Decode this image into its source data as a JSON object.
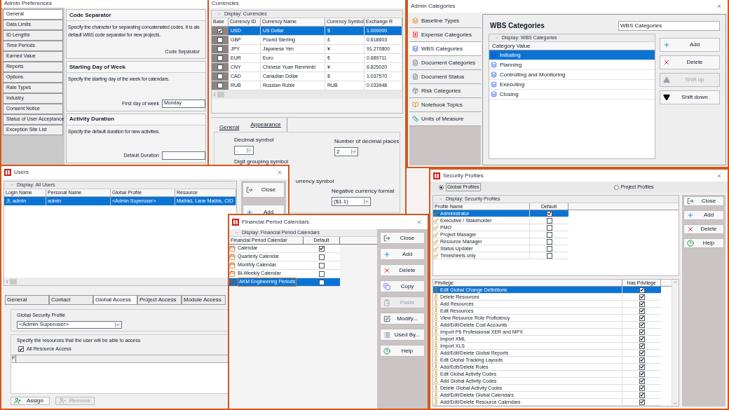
{
  "admin_preferences": {
    "title": "Admin Preferences",
    "tabs": [
      {
        "label": "General",
        "selected": true
      },
      {
        "label": "Data Limits",
        "selected": false
      },
      {
        "label": "ID Lengths",
        "selected": false
      },
      {
        "label": "Time Periods",
        "selected": false
      },
      {
        "label": "Earned Value",
        "selected": false
      },
      {
        "label": "Reports",
        "selected": false
      },
      {
        "label": "Options",
        "selected": false
      },
      {
        "label": "Rate Types",
        "selected": false
      },
      {
        "label": "Industry",
        "selected": false
      },
      {
        "label": "Consent Notice",
        "selected": false
      },
      {
        "label": "Status of User Acceptance",
        "selected": false
      },
      {
        "label": "Exception Site List",
        "selected": false
      }
    ],
    "sections": [
      {
        "heading": "Code Separator",
        "lines": [
          "Specify the character for separating concatenated codes.  It is als",
          "default WBS code separator for new projects."
        ],
        "field": {
          "label": "Code Separator",
          "kind": "label_only"
        }
      },
      {
        "heading": "Starting Day of Week",
        "lines": [
          "Specify the starting day of the week for calendars."
        ],
        "field": {
          "label": "First day of week",
          "kind": "input",
          "value": "Monday"
        }
      },
      {
        "heading": "Activity Duration",
        "lines": [
          "Specify the default duration for new activities."
        ],
        "field": {
          "label": "Default Duration",
          "kind": "input"
        }
      }
    ]
  },
  "currencies": {
    "title": "Currencies",
    "display": "Display: Currencies",
    "base_column": "Base",
    "columns": [
      "Currency ID",
      "Currency Name",
      "Currency Symbol",
      "Exchange R"
    ],
    "rows": [
      {
        "base": true,
        "selected": true,
        "cells": [
          "USD",
          "US Dollar",
          "$",
          "1.000000"
        ]
      },
      {
        "base": false,
        "selected": false,
        "cells": [
          "GBP",
          "Pound Sterling",
          "£",
          "0.618603"
        ]
      },
      {
        "base": false,
        "selected": false,
        "cells": [
          "JPY",
          "Japanese Yen",
          "¥",
          "91.270800"
        ]
      },
      {
        "base": false,
        "selected": false,
        "cells": [
          "EUR",
          "Euro",
          "€",
          "0.689711"
        ]
      },
      {
        "base": false,
        "selected": false,
        "cells": [
          "CNY",
          "Chinese Yuan Renminbi",
          "¥",
          "6.825020"
        ]
      },
      {
        "base": false,
        "selected": false,
        "cells": [
          "CAD",
          "Canadian Dollar",
          "$",
          "1.037570"
        ]
      },
      {
        "base": false,
        "selected": false,
        "cells": [
          "RUB",
          "Russian Ruble",
          "RUB",
          "0.033948"
        ]
      }
    ],
    "tabs": [
      {
        "label": "General",
        "selected": false
      },
      {
        "label": "Appearance",
        "selected": true
      }
    ],
    "decimal_symbol": {
      "label": "Decimal symbol",
      "value": "."
    },
    "decimal_places": {
      "label": "Number of decimal places",
      "value": "2"
    },
    "digit_grouping": {
      "label": "Digit grouping symbol"
    },
    "currency_symbol": {
      "label": "urrency symbol"
    },
    "negative_format": {
      "label": "Negative currency format",
      "value": "($1.1)"
    }
  },
  "admin_categories": {
    "title": "Admin Categories",
    "nav": [
      {
        "label": "Baseline Types",
        "selected": false
      },
      {
        "label": "Expense Categories",
        "selected": false
      },
      {
        "label": "WBS Categories",
        "selected": true
      },
      {
        "label": "Document Categories",
        "selected": false
      },
      {
        "label": "Document Status",
        "selected": false
      },
      {
        "label": "Risk Categories",
        "selected": false
      },
      {
        "label": "Notebook Topics",
        "selected": false
      },
      {
        "label": "Units of Measure",
        "selected": false
      }
    ],
    "heading": "WBS Categories",
    "name_value": "WBS Categories",
    "display": "Display: WBS Categories",
    "column": "Category Value",
    "rows": [
      {
        "label": "Initiating",
        "selected": true
      },
      {
        "label": "Planning",
        "selected": false
      },
      {
        "label": "Controlling and Monitoring",
        "selected": false
      },
      {
        "label": "Executing",
        "selected": false
      },
      {
        "label": "Closing",
        "selected": false
      }
    ],
    "buttons": [
      {
        "label": "Add",
        "kind": "add",
        "disabled": false
      },
      {
        "label": "Delete",
        "kind": "delete",
        "disabled": false
      },
      {
        "label": "Shift up",
        "kind": "shift_up",
        "disabled": true
      },
      {
        "label": "Shift down",
        "kind": "shift_down",
        "disabled": false
      }
    ]
  },
  "users": {
    "title": "Users",
    "display": "Display: All Users",
    "columns": [
      "Login Name",
      "Personal Name",
      "Global Profile",
      "Resource"
    ],
    "rows": [
      {
        "selected": true,
        "cells": [
          "admin",
          "admin",
          "<Admin Superuser>",
          "MathisL Lane Mathis, CIO"
        ]
      }
    ],
    "buttons": [
      {
        "label": "Close",
        "kind": "close",
        "disabled": false
      },
      {
        "label": "Add",
        "kind": "add",
        "disabled": false
      }
    ],
    "tabs": [
      {
        "label": "General",
        "selected": false
      },
      {
        "label": "Contact",
        "selected": false
      },
      {
        "label": "Global Access",
        "selected": true
      },
      {
        "label": "Project Access",
        "selected": false
      },
      {
        "label": "Module Access",
        "selected": false
      }
    ],
    "profile": {
      "label": "Global Security Profile",
      "value": "<Admin Superuser>"
    },
    "access_note": "Specify the resources that the user will be able to access",
    "all_access": {
      "label": "All Resource Access",
      "checked": true
    },
    "grid_column": "F",
    "bottom_buttons": [
      {
        "label": "Assign",
        "kind": "assign",
        "disabled": false
      },
      {
        "label": "Remove",
        "kind": "remove",
        "disabled": true
      }
    ]
  },
  "financial_calendars": {
    "title": "Financial Period Calendars",
    "display": "Display: Financial Period Calendars",
    "columns": [
      "Financial Period Calendar",
      "Default"
    ],
    "rows": [
      {
        "label": "Calendar",
        "default": true,
        "selected": false
      },
      {
        "label": "Quarterly Calendar",
        "default": false,
        "selected": false
      },
      {
        "label": "Monthly Calendar",
        "default": false,
        "selected": false
      },
      {
        "label": "Bi-Weekly Calendar",
        "default": false,
        "selected": false
      },
      {
        "label": "AKM Engineering Periods",
        "default": false,
        "selected": true
      }
    ],
    "buttons": [
      {
        "label": "Close",
        "kind": "close",
        "disabled": false
      },
      {
        "label": "Add",
        "kind": "add",
        "disabled": false
      },
      {
        "label": "Delete",
        "kind": "delete",
        "disabled": false
      },
      {
        "label": "Copy",
        "kind": "copy",
        "disabled": false
      },
      {
        "label": "Paste",
        "kind": "paste",
        "disabled": true
      },
      {
        "label": "Modify...",
        "kind": "modify",
        "disabled": false
      },
      {
        "label": "Used By...",
        "kind": "used_by",
        "disabled": false
      },
      {
        "label": "Help",
        "kind": "help",
        "disabled": false
      }
    ]
  },
  "security_profiles": {
    "title": "Security Profiles",
    "scopes": [
      {
        "label": "Global Profiles",
        "selected": true
      },
      {
        "label": "Project Profiles",
        "selected": false
      }
    ],
    "display": "Display: Security Profiles",
    "profile_columns": [
      "Profile Name",
      "Default"
    ],
    "profiles": [
      {
        "name": "Administrator",
        "default": true,
        "selected": true
      },
      {
        "name": "Executive / Stakeholder",
        "default": false,
        "selected": false
      },
      {
        "name": "PMO",
        "default": false,
        "selected": false
      },
      {
        "name": "Project Manager",
        "default": false,
        "selected": false
      },
      {
        "name": "Resource Manager",
        "default": false,
        "selected": false
      },
      {
        "name": "Status Updater",
        "default": false,
        "selected": false
      },
      {
        "name": "Timesheets only",
        "default": false,
        "selected": false
      }
    ],
    "buttons": [
      {
        "label": "Close",
        "kind": "close",
        "disabled": false
      },
      {
        "label": "Add",
        "kind": "add",
        "disabled": false
      },
      {
        "label": "Delete",
        "kind": "delete",
        "disabled": false
      },
      {
        "label": "Help",
        "kind": "help",
        "disabled": false
      }
    ],
    "privilege_columns": [
      "Privilege",
      "Has Privilege"
    ],
    "privileges": [
      {
        "name": "Edit Global Change Definitions",
        "checked": true,
        "selected": true
      },
      {
        "name": "Delete Resources",
        "checked": true,
        "selected": false
      },
      {
        "name": "Add Resources",
        "checked": true,
        "selected": false
      },
      {
        "name": "Edit Resources",
        "checked": true,
        "selected": false
      },
      {
        "name": "View Resource Role Proficiency",
        "checked": true,
        "selected": false
      },
      {
        "name": "Add/Edit/Delete Cost Accounts",
        "checked": true,
        "selected": false
      },
      {
        "name": "Import P6 Professional XER and MPX",
        "checked": true,
        "selected": false
      },
      {
        "name": "Import XML",
        "checked": true,
        "selected": false
      },
      {
        "name": "Import XLS",
        "checked": true,
        "selected": false
      },
      {
        "name": "Add/Edit/Delete Global Reports",
        "checked": true,
        "selected": false
      },
      {
        "name": "Edit Global Tracking Layouts",
        "checked": true,
        "selected": false
      },
      {
        "name": "Add/Edit/Delete Roles",
        "checked": true,
        "selected": false
      },
      {
        "name": "Edit Global Activity Codes",
        "checked": true,
        "selected": false
      },
      {
        "name": "Add Global Activity Codes",
        "checked": true,
        "selected": false
      },
      {
        "name": "Delete Global Activity Codes",
        "checked": true,
        "selected": false
      },
      {
        "name": "Add/Edit/Delete Global Calendars",
        "checked": true,
        "selected": false
      },
      {
        "name": "Add/Edit/Delete Resource Calendars",
        "checked": true,
        "selected": false
      }
    ]
  }
}
